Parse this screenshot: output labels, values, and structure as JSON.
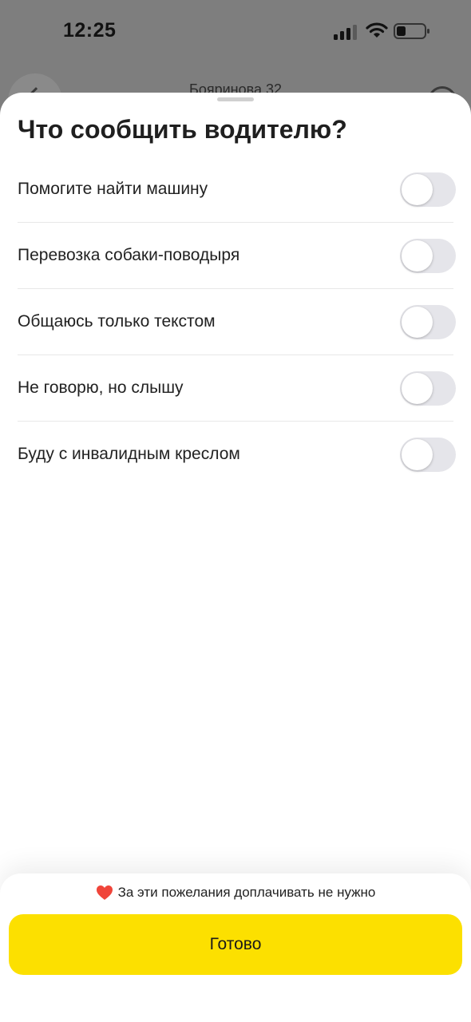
{
  "status_bar": {
    "time": "12:25"
  },
  "background": {
    "address": "Бояринова 32"
  },
  "sheet": {
    "title": "Что сообщить водителю?",
    "options": [
      {
        "label": "Помогите найти машину",
        "enabled": false
      },
      {
        "label": "Перевозка собаки-поводыря",
        "enabled": false
      },
      {
        "label": "Общаюсь только текстом",
        "enabled": false
      },
      {
        "label": "Не говорю, но слышу",
        "enabled": false
      },
      {
        "label": "Буду с инвалидным креслом",
        "enabled": false
      }
    ]
  },
  "footer": {
    "note": "За эти пожелания доплачивать не нужно",
    "heart_color": "#f0453a",
    "done_label": "Готово",
    "button_color": "#fce000"
  }
}
